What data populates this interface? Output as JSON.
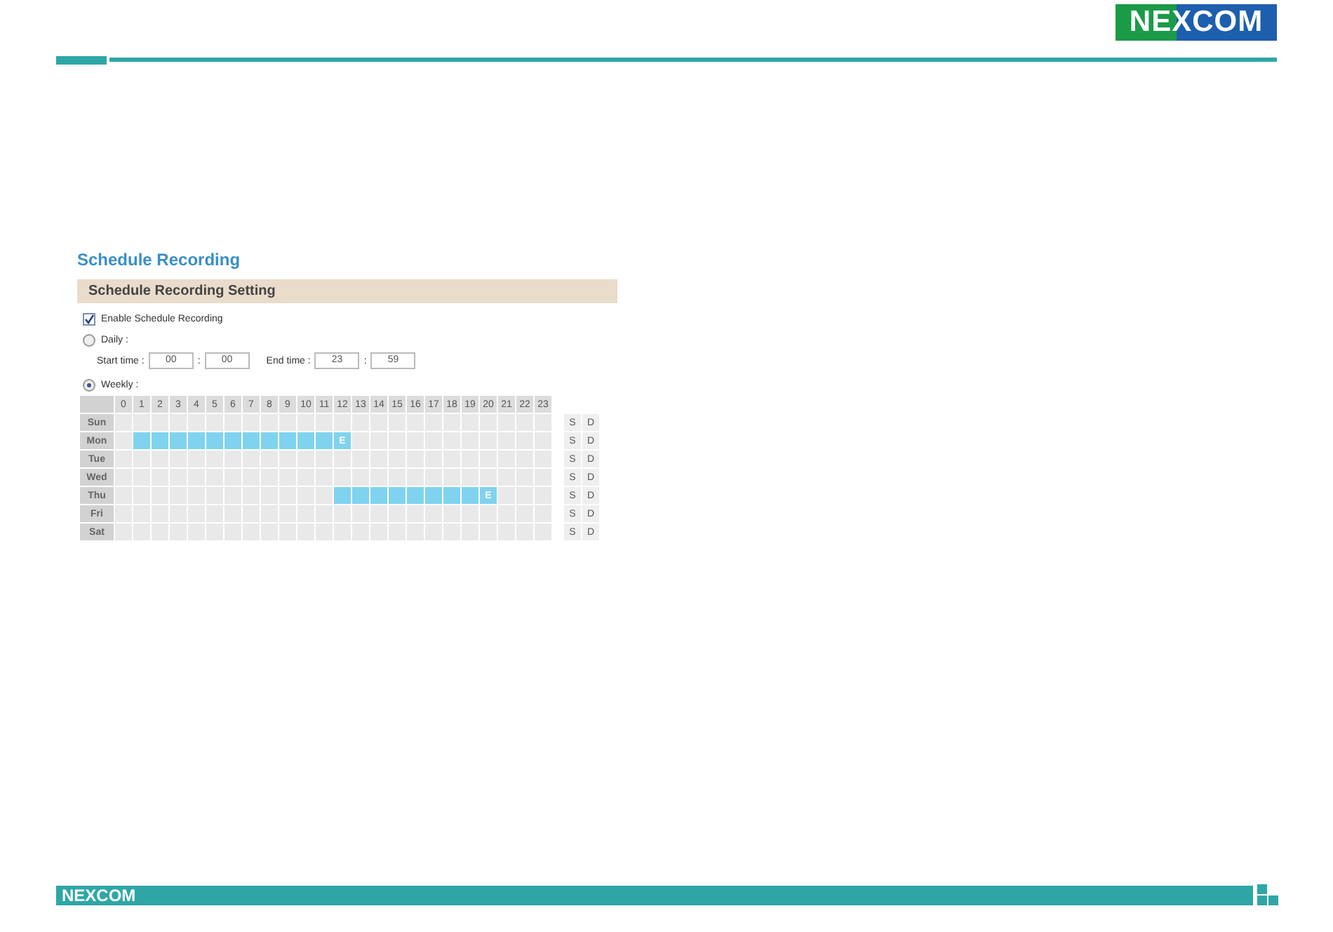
{
  "header": {
    "logo": "NEXCOM"
  },
  "page_title": "Schedule Recording",
  "section_title": "Schedule Recording Setting",
  "enable": {
    "label": "Enable Schedule Recording",
    "checked": true
  },
  "daily": {
    "label": "Daily :",
    "selected": false,
    "start_label": "Start time :",
    "start_hour": "00",
    "start_separator": ":",
    "start_minute": "00",
    "end_label": "End time :",
    "end_hour": "23",
    "end_separator": ":",
    "end_minute": "59"
  },
  "weekly": {
    "label": "Weekly :",
    "selected": true
  },
  "hours": [
    "0",
    "1",
    "2",
    "3",
    "4",
    "5",
    "6",
    "7",
    "8",
    "9",
    "10",
    "11",
    "12",
    "13",
    "14",
    "15",
    "16",
    "17",
    "18",
    "19",
    "20",
    "21",
    "22",
    "23"
  ],
  "days": [
    {
      "name": "Sun",
      "cells": [
        {
          "on": false
        },
        {
          "on": false
        },
        {
          "on": false
        },
        {
          "on": false
        },
        {
          "on": false
        },
        {
          "on": false
        },
        {
          "on": false
        },
        {
          "on": false
        },
        {
          "on": false
        },
        {
          "on": false
        },
        {
          "on": false
        },
        {
          "on": false
        },
        {
          "on": false
        },
        {
          "on": false
        },
        {
          "on": false
        },
        {
          "on": false
        },
        {
          "on": false
        },
        {
          "on": false
        },
        {
          "on": false
        },
        {
          "on": false
        },
        {
          "on": false
        },
        {
          "on": false
        },
        {
          "on": false
        },
        {
          "on": false
        }
      ],
      "s": "S",
      "d": "D"
    },
    {
      "name": "Mon",
      "cells": [
        {
          "on": false
        },
        {
          "on": true
        },
        {
          "on": true
        },
        {
          "on": true
        },
        {
          "on": true
        },
        {
          "on": true
        },
        {
          "on": true
        },
        {
          "on": true
        },
        {
          "on": true
        },
        {
          "on": true
        },
        {
          "on": true
        },
        {
          "on": true
        },
        {
          "on": true,
          "text": "E"
        },
        {
          "on": false
        },
        {
          "on": false
        },
        {
          "on": false
        },
        {
          "on": false
        },
        {
          "on": false
        },
        {
          "on": false
        },
        {
          "on": false
        },
        {
          "on": false
        },
        {
          "on": false
        },
        {
          "on": false
        },
        {
          "on": false
        }
      ],
      "s": "S",
      "d": "D"
    },
    {
      "name": "Tue",
      "cells": [
        {
          "on": false
        },
        {
          "on": false
        },
        {
          "on": false
        },
        {
          "on": false
        },
        {
          "on": false
        },
        {
          "on": false
        },
        {
          "on": false
        },
        {
          "on": false
        },
        {
          "on": false
        },
        {
          "on": false
        },
        {
          "on": false
        },
        {
          "on": false
        },
        {
          "on": false
        },
        {
          "on": false
        },
        {
          "on": false
        },
        {
          "on": false
        },
        {
          "on": false
        },
        {
          "on": false
        },
        {
          "on": false
        },
        {
          "on": false
        },
        {
          "on": false
        },
        {
          "on": false
        },
        {
          "on": false
        },
        {
          "on": false
        }
      ],
      "s": "S",
      "d": "D"
    },
    {
      "name": "Wed",
      "cells": [
        {
          "on": false
        },
        {
          "on": false
        },
        {
          "on": false
        },
        {
          "on": false
        },
        {
          "on": false
        },
        {
          "on": false
        },
        {
          "on": false
        },
        {
          "on": false
        },
        {
          "on": false
        },
        {
          "on": false
        },
        {
          "on": false
        },
        {
          "on": false
        },
        {
          "on": false
        },
        {
          "on": false
        },
        {
          "on": false
        },
        {
          "on": false
        },
        {
          "on": false
        },
        {
          "on": false
        },
        {
          "on": false
        },
        {
          "on": false
        },
        {
          "on": false
        },
        {
          "on": false
        },
        {
          "on": false
        },
        {
          "on": false
        }
      ],
      "s": "S",
      "d": "D"
    },
    {
      "name": "Thu",
      "cells": [
        {
          "on": false
        },
        {
          "on": false
        },
        {
          "on": false
        },
        {
          "on": false
        },
        {
          "on": false
        },
        {
          "on": false
        },
        {
          "on": false
        },
        {
          "on": false
        },
        {
          "on": false
        },
        {
          "on": false
        },
        {
          "on": false
        },
        {
          "on": false
        },
        {
          "on": true
        },
        {
          "on": true
        },
        {
          "on": true
        },
        {
          "on": true
        },
        {
          "on": true
        },
        {
          "on": true
        },
        {
          "on": true
        },
        {
          "on": true
        },
        {
          "on": true,
          "text": "E"
        },
        {
          "on": false
        },
        {
          "on": false
        },
        {
          "on": false
        }
      ],
      "s": "S",
      "d": "D"
    },
    {
      "name": "Fri",
      "cells": [
        {
          "on": false
        },
        {
          "on": false
        },
        {
          "on": false
        },
        {
          "on": false
        },
        {
          "on": false
        },
        {
          "on": false
        },
        {
          "on": false
        },
        {
          "on": false
        },
        {
          "on": false
        },
        {
          "on": false
        },
        {
          "on": false
        },
        {
          "on": false
        },
        {
          "on": false
        },
        {
          "on": false
        },
        {
          "on": false
        },
        {
          "on": false
        },
        {
          "on": false
        },
        {
          "on": false
        },
        {
          "on": false
        },
        {
          "on": false
        },
        {
          "on": false
        },
        {
          "on": false
        },
        {
          "on": false
        },
        {
          "on": false
        }
      ],
      "s": "S",
      "d": "D"
    },
    {
      "name": "Sat",
      "cells": [
        {
          "on": false
        },
        {
          "on": false
        },
        {
          "on": false
        },
        {
          "on": false
        },
        {
          "on": false
        },
        {
          "on": false
        },
        {
          "on": false
        },
        {
          "on": false
        },
        {
          "on": false
        },
        {
          "on": false
        },
        {
          "on": false
        },
        {
          "on": false
        },
        {
          "on": false
        },
        {
          "on": false
        },
        {
          "on": false
        },
        {
          "on": false
        },
        {
          "on": false
        },
        {
          "on": false
        },
        {
          "on": false
        },
        {
          "on": false
        },
        {
          "on": false
        },
        {
          "on": false
        },
        {
          "on": false
        },
        {
          "on": false
        }
      ],
      "s": "S",
      "d": "D"
    }
  ],
  "footer": {
    "logo": "NEXCOM"
  }
}
